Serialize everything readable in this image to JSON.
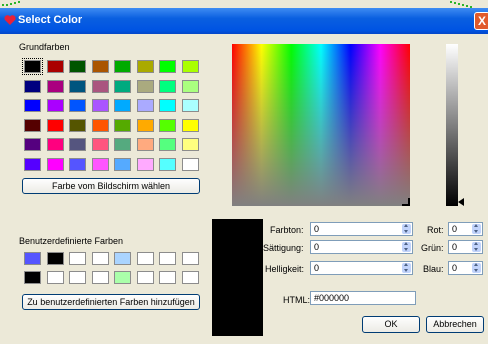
{
  "window": {
    "title": "Select Color",
    "close_label": "X"
  },
  "basic": {
    "label": "Grundfarben",
    "colors": [
      [
        "#000000",
        "#aa0000",
        "#005500",
        "#aa5500",
        "#00aa00",
        "#aaaa00",
        "#00ff00",
        "#aaff00"
      ],
      [
        "#00007f",
        "#aa007f",
        "#00557f",
        "#aa557f",
        "#00aa7f",
        "#aaaa7f",
        "#00ff7f",
        "#aaff7f"
      ],
      [
        "#0000ff",
        "#aa00ff",
        "#0055ff",
        "#aa55ff",
        "#00aaff",
        "#aaaaff",
        "#00ffff",
        "#aaffff"
      ],
      [
        "#550000",
        "#ff0000",
        "#555500",
        "#ff5500",
        "#55aa00",
        "#ffaa00",
        "#55ff00",
        "#ffff00"
      ],
      [
        "#55007f",
        "#ff007f",
        "#55557f",
        "#ff557f",
        "#55aa7f",
        "#ffaa7f",
        "#55ff7f",
        "#ffff7f"
      ],
      [
        "#5500ff",
        "#ff00ff",
        "#5555ff",
        "#ff55ff",
        "#55aaff",
        "#ffaaff",
        "#55ffff",
        "#ffffff"
      ]
    ]
  },
  "pick_screen_button": "Farbe vom Bildschirm wählen",
  "custom": {
    "label": "Benutzerdefinierte Farben",
    "colors": [
      [
        "#5555ff",
        "#000000",
        "#ffffff",
        "#ffffff",
        "#aad4ff",
        "#ffffff",
        "#ffffff",
        "#ffffff"
      ],
      [
        "#000000",
        "#ffffff",
        "#ffffff",
        "#ffffff",
        "#aaffaa",
        "#ffffff",
        "#ffffff",
        "#ffffff"
      ]
    ]
  },
  "add_custom_button": "Zu benutzerdefinierten Farben hinzufügen",
  "fields": {
    "hue_label": "Farbton:",
    "hue_value": "0",
    "sat_label": "Sättigung:",
    "sat_value": "0",
    "val_label": "Helligkeit:",
    "val_value": "0",
    "red_label": "Rot:",
    "red_value": "0",
    "green_label": "Grün:",
    "green_value": "0",
    "blue_label": "Blau:",
    "blue_value": "0",
    "html_label": "HTML:",
    "html_value": "#000000"
  },
  "buttons": {
    "ok": "OK",
    "cancel": "Abbrechen"
  },
  "colors": {
    "current": "#000000"
  }
}
